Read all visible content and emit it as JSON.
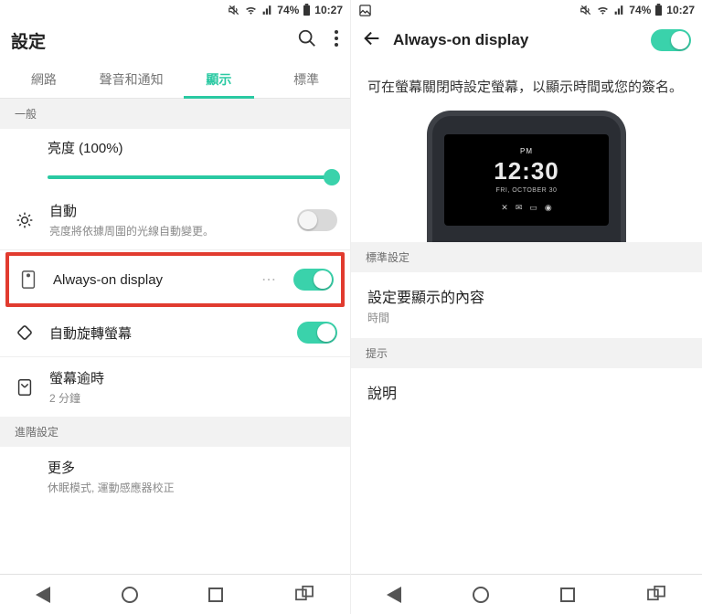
{
  "status": {
    "battery_pct": "74%",
    "time": "10:27"
  },
  "left": {
    "title": "設定",
    "tabs": [
      "網路",
      "聲音和通知",
      "顯示",
      "標準"
    ],
    "active_tab_index": 2,
    "section_general": "一般",
    "brightness": {
      "label": "亮度 (100%)",
      "auto_label": "自動",
      "auto_desc": "亮度將依據周圍的光線自動變更。"
    },
    "aod": {
      "label": "Always-on display"
    },
    "rotate": {
      "label": "自動旋轉螢幕"
    },
    "timeout": {
      "label": "螢幕逾時",
      "value": "2 分鐘"
    },
    "section_advanced": "進階設定",
    "more": {
      "label": "更多",
      "desc": "休眠模式, 運動感應器校正"
    }
  },
  "right": {
    "title": "Always-on display",
    "description": "可在螢幕關閉時設定螢幕，以顯示時間或您的簽名。",
    "clock": {
      "ampm": "PM",
      "time": "12:30",
      "date": "FRI, OCTOBER 30"
    },
    "section_standard": "標準設定",
    "content": {
      "label": "設定要顯示的內容",
      "value": "時間"
    },
    "section_tip": "提示",
    "help": {
      "label": "說明"
    }
  },
  "colors": {
    "accent": "#3ad2ab",
    "highlight": "#e13b2f"
  }
}
